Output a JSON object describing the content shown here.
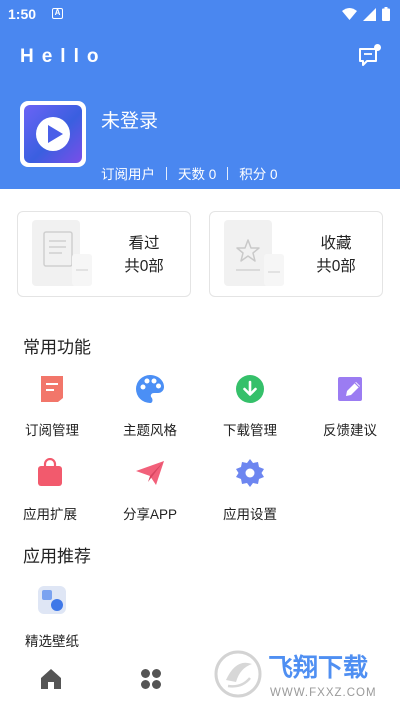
{
  "status_bar": {
    "time": "1:50",
    "notification_badge": "A"
  },
  "app_bar": {
    "title": "Hello"
  },
  "profile": {
    "username": "未登录",
    "member_type": "订阅用户",
    "days": "天数 0",
    "points": "积分 0"
  },
  "cards": [
    {
      "title": "看过",
      "count": "共0部"
    },
    {
      "title": "收藏",
      "count": "共0部"
    }
  ],
  "common_functions": {
    "title": "常用功能",
    "items": [
      {
        "label": "订阅管理",
        "icon": "subscription-icon",
        "color": "#f2766a"
      },
      {
        "label": "主题风格",
        "icon": "palette-icon",
        "color": "#4b8ff5"
      },
      {
        "label": "下载管理",
        "icon": "download-icon",
        "color": "#35c06a"
      },
      {
        "label": "反馈建议",
        "icon": "feedback-edit-icon",
        "color": "#9b7cf2"
      },
      {
        "label": "应用扩展",
        "icon": "shopping-bag-icon",
        "color": "#f25a6d"
      },
      {
        "label": "分享APP",
        "icon": "paper-plane-icon",
        "color": "#f2607a"
      },
      {
        "label": "应用设置",
        "icon": "settings-gear-icon",
        "color": "#6d86f0"
      }
    ]
  },
  "recommendations": {
    "title": "应用推荐",
    "items": [
      {
        "label": "精选壁纸",
        "icon": "wallpaper-icon"
      }
    ]
  },
  "watermark": {
    "brand": "飞翔下载",
    "url": "WWW.FXXZ.COM"
  },
  "colors": {
    "primary": "#4a87f0",
    "background": "#ffffff",
    "text": "#222222"
  }
}
